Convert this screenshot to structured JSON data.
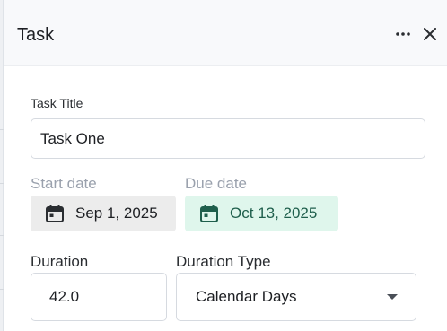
{
  "panel": {
    "title": "Task"
  },
  "form": {
    "task_title_label": "Task Title",
    "task_title_value": "Task One",
    "start_date_label": "Start date",
    "start_date_value": "Sep 1, 2025",
    "due_date_label": "Due date",
    "due_date_value": "Oct 13, 2025",
    "duration_label": "Duration",
    "duration_value": "42.0",
    "duration_type_label": "Duration Type",
    "duration_type_value": "Calendar Days"
  },
  "icons": {
    "more": "more-horizontal-icon",
    "close": "close-icon",
    "calendar": "calendar-icon",
    "dropdown": "chevron-down-icon"
  },
  "colors": {
    "due_pill_bg": "#dff6ec",
    "due_pill_text": "#1f5f4c",
    "start_pill_bg": "#ececec",
    "muted_label": "#9aa1ad"
  }
}
